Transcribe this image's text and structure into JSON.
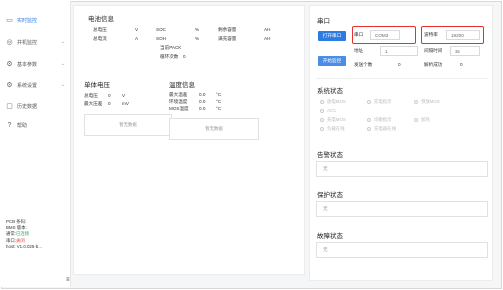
{
  "sidebar": {
    "items": [
      {
        "label": "实时监控",
        "icon": "monitor-icon",
        "chev": ""
      },
      {
        "label": "并机监控",
        "icon": "parallel-icon",
        "chev": "⌄"
      },
      {
        "label": "基本参数",
        "icon": "settings-icon",
        "chev": "⌄"
      },
      {
        "label": "系统设置",
        "icon": "system-icon",
        "chev": "⌄"
      },
      {
        "label": "历史数据",
        "icon": "folder-icon",
        "chev": ""
      },
      {
        "label": "帮助",
        "icon": "help-icon",
        "chev": ""
      }
    ],
    "info": {
      "pcb": "PCB 条码:",
      "bms": "BMS 版本:",
      "comm_label": "通常:",
      "comm_value": "已连接",
      "port_label": "串口:",
      "port_value": "关闭",
      "host": "host: V1.0.025-b..."
    },
    "collapse": "≡"
  },
  "battery_info": {
    "title": "电池信息",
    "rows": [
      [
        {
          "t": "总电压"
        },
        {
          "t": "V"
        },
        {
          "t": "SOC"
        },
        {
          "t": "%"
        },
        {
          "t": "剩余容量"
        },
        {
          "t": "AH"
        }
      ],
      [
        {
          "t": "总电流"
        },
        {
          "t": "A"
        },
        {
          "t": "SOH"
        },
        {
          "t": "%"
        },
        {
          "t": "满充容量"
        },
        {
          "t": "AH"
        }
      ]
    ],
    "pack_label": "当前PACK",
    "cycle_label": "循环次数",
    "cycle_value": "0"
  },
  "cell_voltage": {
    "title": "单体电压",
    "total_label": "总电压",
    "total_value": "0",
    "total_unit": "V",
    "maxdiff_label": "最大压差",
    "maxdiff_value": "0",
    "maxdiff_unit": "mV",
    "empty": "暂无数据"
  },
  "temperature": {
    "title": "温度信息",
    "rows": [
      {
        "label": "最大温差",
        "value": "0.0",
        "unit": "°C"
      },
      {
        "label": "环境温度",
        "value": "0.0",
        "unit": "°C"
      },
      {
        "label": "MOS温度",
        "value": "0.0",
        "unit": "°C"
      }
    ],
    "empty": "暂无数据"
  },
  "serial": {
    "title": "串口",
    "open_button": "打开串口",
    "port_label": "串口",
    "port_value": "COM3",
    "baud_label": "波特率",
    "baud_value": "19200",
    "address_label": "地址",
    "address_value": "1",
    "interval_label": "间隔时间",
    "interval_value": "3s",
    "start_button": "开始监控",
    "sent_label": "发送个数",
    "sent_value": "0",
    "parsed_label": "解析成功",
    "parsed_value": "0"
  },
  "system_status": {
    "title": "系统状态",
    "items": [
      "放电MOS",
      "充电指示",
      "预放MOS",
      "ACC",
      "充电MOS",
      "均衡指示",
      "加热",
      "负载在线",
      "充电器在线"
    ]
  },
  "alarm": {
    "title": "告警状态",
    "value": "无"
  },
  "protect": {
    "title": "保护状态",
    "value": "无"
  },
  "fault": {
    "title": "故障状态",
    "value": "无"
  }
}
